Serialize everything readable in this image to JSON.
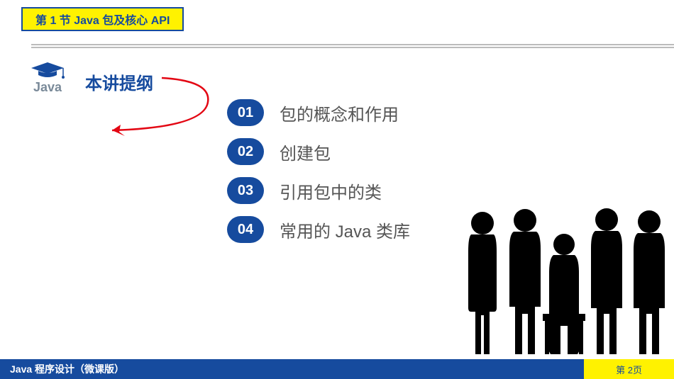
{
  "header": {
    "title": "第 1 节 Java 包及核心 API"
  },
  "logo": {
    "name": "Java"
  },
  "outline": {
    "title": "本讲提纲",
    "items": [
      {
        "num": "01",
        "text": "包的概念和作用"
      },
      {
        "num": "02",
        "text": "创建包"
      },
      {
        "num": "03",
        "text": "引用包中的类"
      },
      {
        "num": "04",
        "text": "常用的 Java 类库"
      }
    ]
  },
  "footer": {
    "left": "Java 程序设计（微课版）",
    "right": "第 2页"
  }
}
